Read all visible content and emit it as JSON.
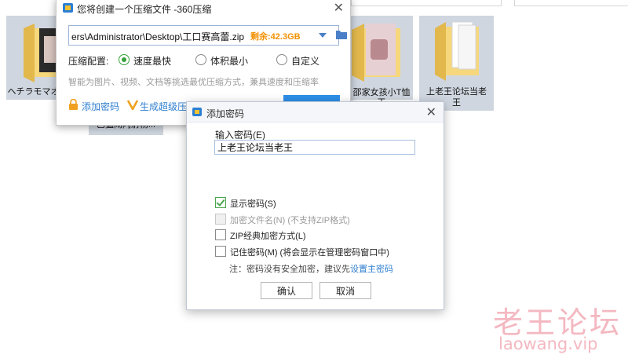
{
  "explorer": {
    "folders": [
      {
        "label": "ヘチラモマオヂ"
      },
      {
        "label": "巴猛闹闪射杨..."
      },
      {
        "label": "邵家女孩小T恤"
      },
      {
        "label": "王"
      },
      {
        "label": "上老王论坛当老"
      },
      {
        "label": "王"
      }
    ]
  },
  "zip_dialog": {
    "title": "您将创建一个压缩文件 -360压缩",
    "path": "ers\\Administrator\\Desktop\\工口赛高蕾.zip",
    "remaining": "剩余:42.3GB",
    "config_label": "压缩配置:",
    "options": [
      "速度最快",
      "体积最小",
      "自定义"
    ],
    "selected_option": "速度最快",
    "hint": "智能为图片、视频、文档等挑选最优压缩方式，兼具速度和压缩率",
    "add_password": "添加密码",
    "make_self_extract": "生成超级压缩"
  },
  "password_dialog": {
    "title": "添加密码",
    "input_label": "输入密码(E)",
    "password_value": "上老王论坛当老王",
    "checkboxes": [
      {
        "label": "显示密码(S)",
        "checked": true,
        "enabled": true
      },
      {
        "label": "加密文件名(N) (不支持ZIP格式)",
        "checked": false,
        "enabled": false
      },
      {
        "label": "ZIP经典加密方式(L)",
        "checked": false,
        "enabled": true
      },
      {
        "label": "记住密码(M) (将会显示在管理密码窗口中)",
        "checked": false,
        "enabled": true
      }
    ],
    "note_prefix": "注：密码没有安全加密，建议先",
    "note_link": "设置主密码",
    "ok_label": "确认",
    "cancel_label": "取消"
  },
  "watermark": {
    "line1": "老王论坛",
    "line2": "laowang.vip"
  },
  "colors": {
    "accent": "#2d8fe8",
    "remaining": "#f29100",
    "link": "#2f7fd0",
    "check": "#38a23a",
    "watermark": "#f4b8c1"
  }
}
